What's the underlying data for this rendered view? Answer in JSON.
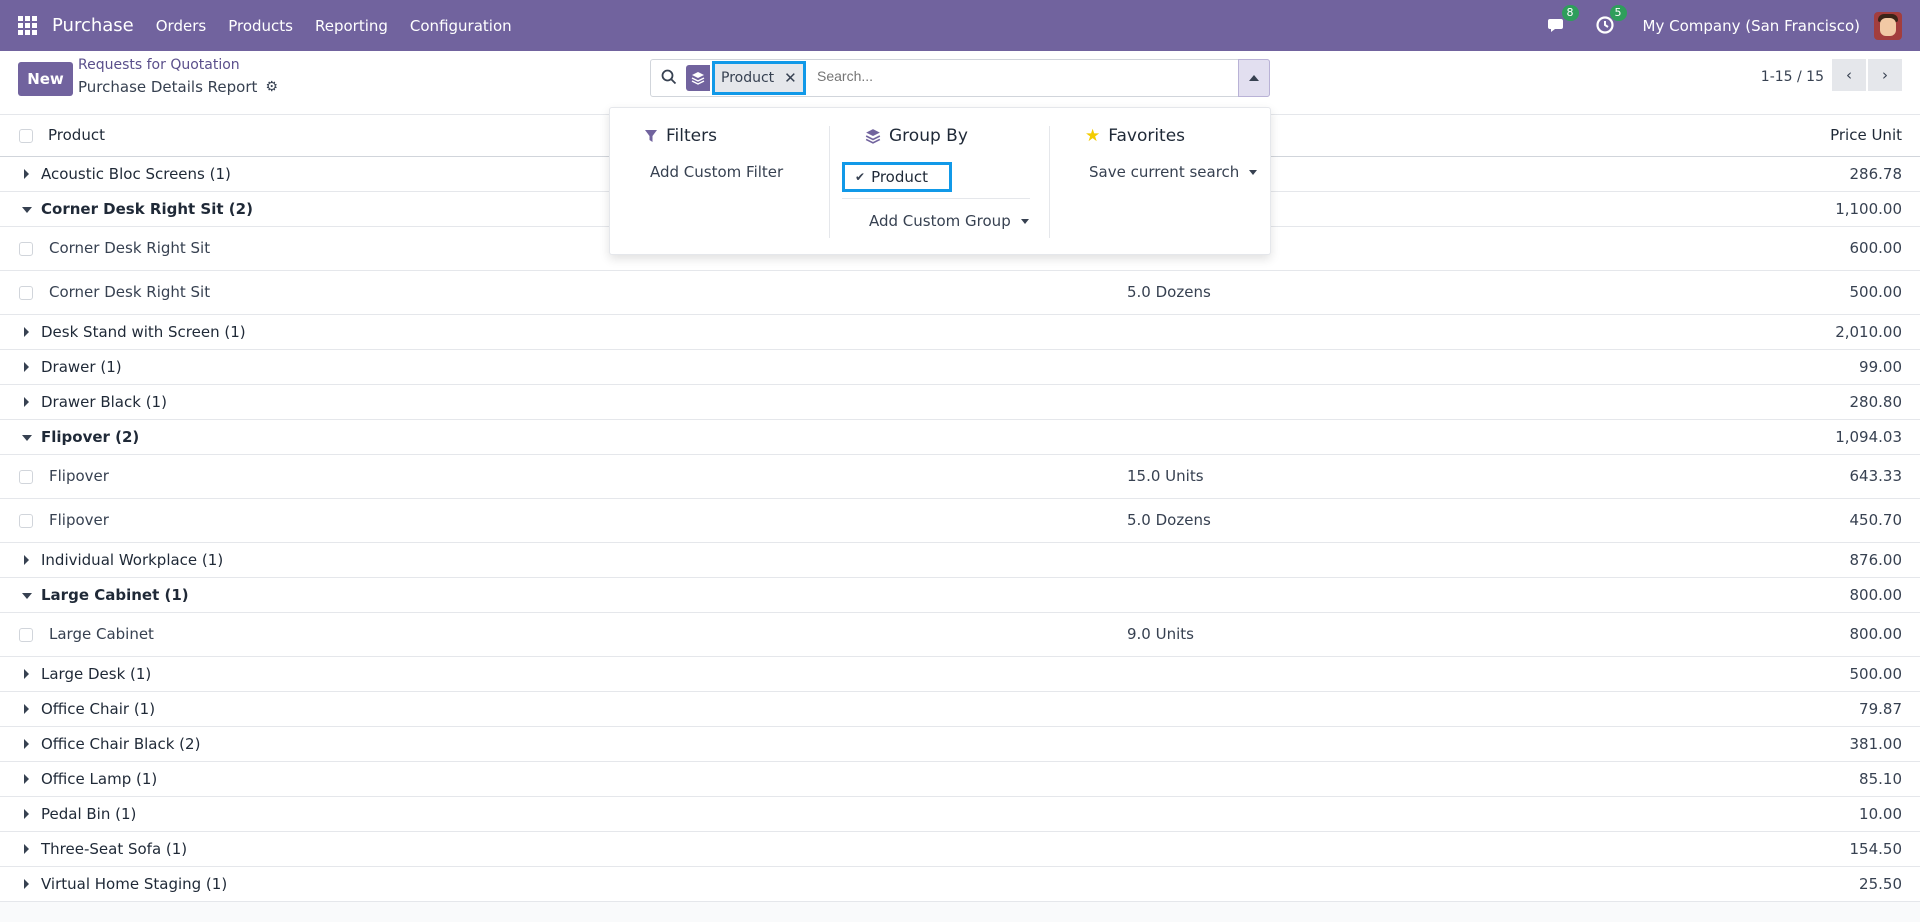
{
  "navbar": {
    "app_name": "Purchase",
    "menu": [
      "Orders",
      "Products",
      "Reporting",
      "Configuration"
    ],
    "messages_count": "8",
    "activities_count": "5",
    "company": "My Company (San Francisco)"
  },
  "control": {
    "new_label": "New",
    "breadcrumb_parent": "Requests for Quotation",
    "breadcrumb_current": "Purchase Details Report",
    "facet_label": "Product",
    "search_placeholder": "Search...",
    "pager": "1-15 / 15"
  },
  "list": {
    "col_product": "Product",
    "col_price": "Price Unit",
    "rows": [
      {
        "type": "group",
        "open": false,
        "label": "Acoustic Bloc Screens (1)",
        "value": "286.78"
      },
      {
        "type": "group",
        "open": true,
        "label": "Corner Desk Right Sit (2)",
        "value": "1,100.00"
      },
      {
        "type": "record",
        "label": "Corner Desk Right Sit",
        "qty": "",
        "value": "600.00"
      },
      {
        "type": "record",
        "label": "Corner Desk Right Sit",
        "qty": "5.0 Dozens",
        "value": "500.00"
      },
      {
        "type": "group",
        "open": false,
        "label": "Desk Stand with Screen (1)",
        "value": "2,010.00"
      },
      {
        "type": "group",
        "open": false,
        "label": "Drawer (1)",
        "value": "99.00"
      },
      {
        "type": "group",
        "open": false,
        "label": "Drawer Black (1)",
        "value": "280.80"
      },
      {
        "type": "group",
        "open": true,
        "label": "Flipover (2)",
        "value": "1,094.03"
      },
      {
        "type": "record",
        "label": "Flipover",
        "qty": "15.0 Units",
        "value": "643.33"
      },
      {
        "type": "record",
        "label": "Flipover",
        "qty": "5.0 Dozens",
        "value": "450.70"
      },
      {
        "type": "group",
        "open": false,
        "label": "Individual Workplace (1)",
        "value": "876.00"
      },
      {
        "type": "group",
        "open": true,
        "label": "Large Cabinet (1)",
        "value": "800.00"
      },
      {
        "type": "record",
        "label": "Large Cabinet",
        "qty": "9.0 Units",
        "value": "800.00"
      },
      {
        "type": "group",
        "open": false,
        "label": "Large Desk (1)",
        "value": "500.00"
      },
      {
        "type": "group",
        "open": false,
        "label": "Office Chair (1)",
        "value": "79.87"
      },
      {
        "type": "group",
        "open": false,
        "label": "Office Chair Black (2)",
        "value": "381.00"
      },
      {
        "type": "group",
        "open": false,
        "label": "Office Lamp (1)",
        "value": "85.10"
      },
      {
        "type": "group",
        "open": false,
        "label": "Pedal Bin (1)",
        "value": "10.00"
      },
      {
        "type": "group",
        "open": false,
        "label": "Three-Seat Sofa (1)",
        "value": "154.50"
      },
      {
        "type": "group",
        "open": false,
        "label": "Virtual Home Staging (1)",
        "value": "25.50"
      }
    ]
  },
  "dropdown": {
    "filters_title": "Filters",
    "add_custom_filter": "Add Custom Filter",
    "groupby_title": "Group By",
    "groupby_product": "Product",
    "add_custom_group": "Add Custom Group",
    "favorites_title": "Favorites",
    "save_current_search": "Save current search"
  },
  "colors": {
    "brand": "#71639e",
    "highlight": "#1199e8",
    "badge": "#2e9e5b",
    "star": "#f3cc00"
  }
}
